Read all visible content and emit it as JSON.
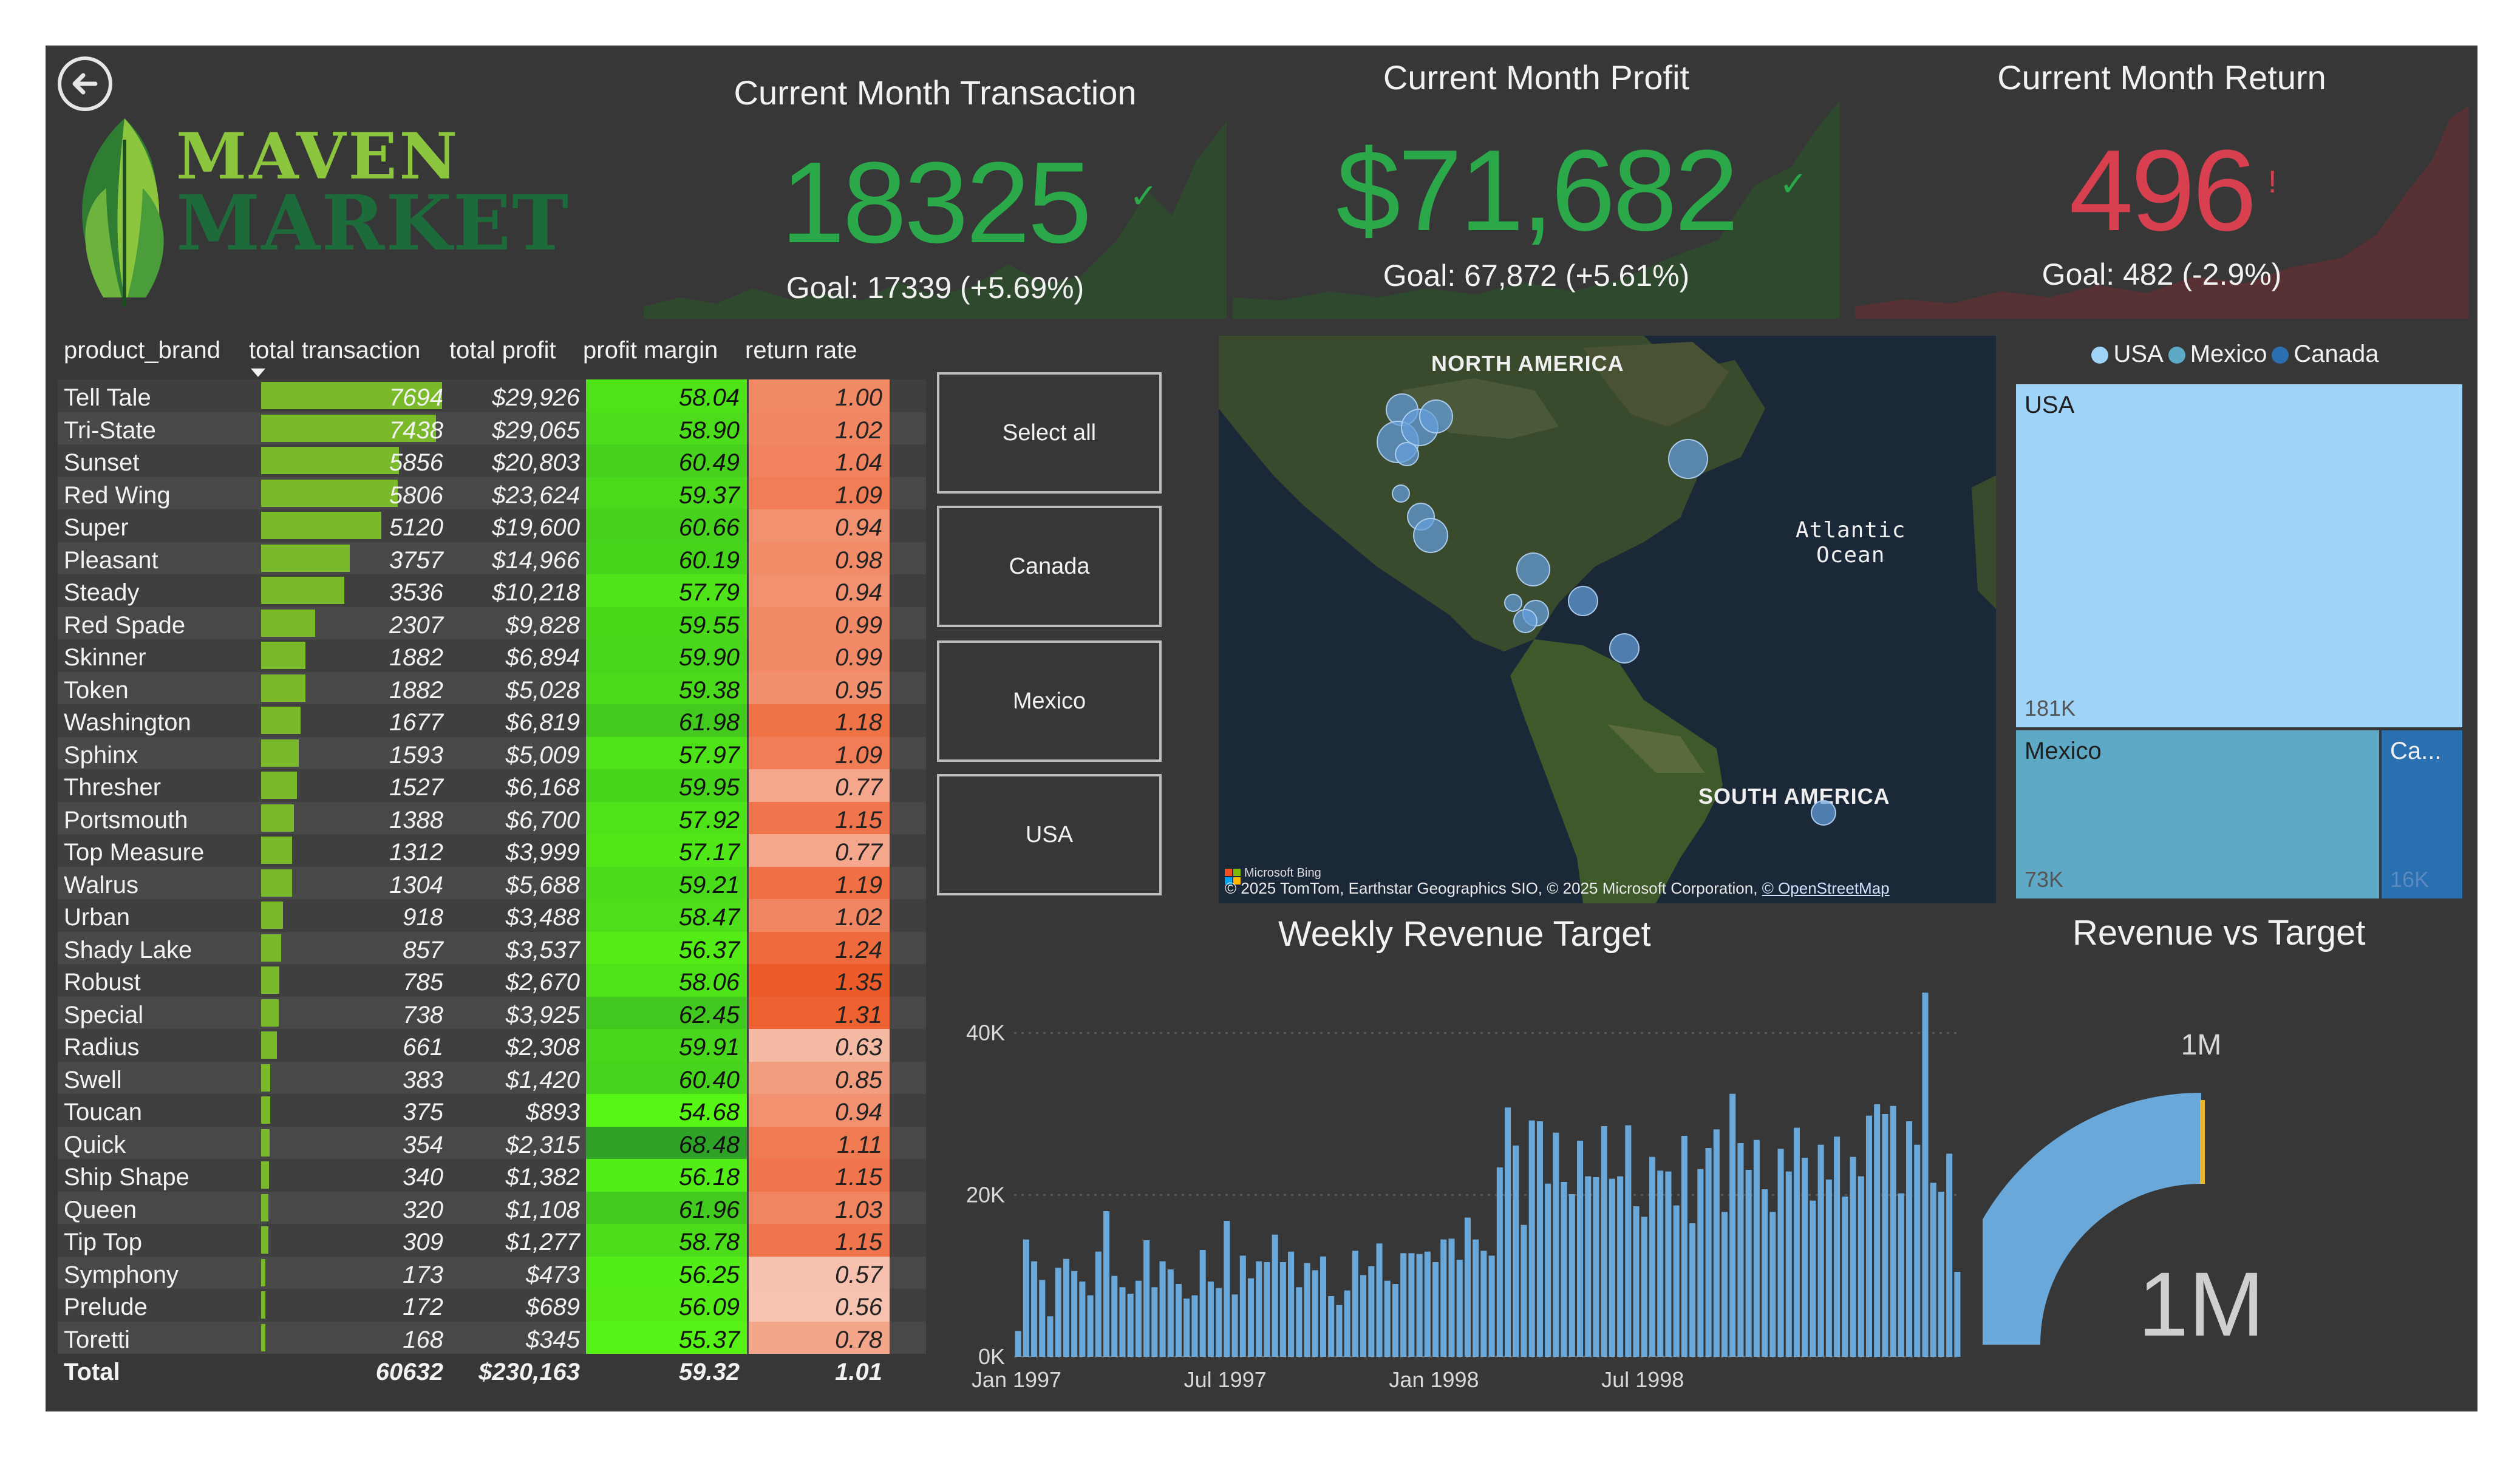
{
  "colors": {
    "background": "#373737",
    "kpi_good": "#2aa84a",
    "kpi_bad": "#d9404f",
    "bar": "#7aba2a",
    "usa": "#9fd3f7",
    "mexico": "#5ea9c6",
    "canada": "#2a6fb0",
    "weekly_bar": "#6aa8d9",
    "gauge": "#6aa8d9"
  },
  "header": {
    "back_icon": "back-arrow-icon",
    "logo_line1": "MAVEN",
    "logo_line2": "MARKET"
  },
  "kpis": [
    {
      "title": "Current Month Transaction",
      "value": "18325",
      "goal": "Goal: 17339 (+5.69%)",
      "status": "check-icon",
      "status_glyph": "✓"
    },
    {
      "title": "Current Month Profit",
      "value": "$71,682",
      "goal": "Goal: 67,872 (+5.61%)",
      "status": "check-icon",
      "status_glyph": "✓"
    },
    {
      "title": "Current Month Return",
      "value": "496",
      "goal": "Goal: 482 (-2.9%)",
      "status": "warning-icon",
      "status_glyph": "!"
    }
  ],
  "table": {
    "columns": [
      "product_brand",
      "total transaction",
      "total profit",
      "profit margin",
      "return rate"
    ],
    "sort_indicator": "sort-desc-icon",
    "rows": [
      {
        "brand": "Tell Tale",
        "tx": 7694,
        "tx_label": "7694",
        "profit": "$29,926",
        "margin": "58.04",
        "rr": "1.00"
      },
      {
        "brand": "Tri-State",
        "tx": 7438,
        "tx_label": "7438",
        "profit": "$29,065",
        "margin": "58.90",
        "rr": "1.02"
      },
      {
        "brand": "Sunset",
        "tx": 5856,
        "tx_label": "5856",
        "profit": "$20,803",
        "margin": "60.49",
        "rr": "1.04"
      },
      {
        "brand": "Red Wing",
        "tx": 5806,
        "tx_label": "5806",
        "profit": "$23,624",
        "margin": "59.37",
        "rr": "1.09"
      },
      {
        "brand": "Super",
        "tx": 5120,
        "tx_label": "5120",
        "profit": "$19,600",
        "margin": "60.66",
        "rr": "0.94"
      },
      {
        "brand": "Pleasant",
        "tx": 3757,
        "tx_label": "3757",
        "profit": "$14,966",
        "margin": "60.19",
        "rr": "0.98"
      },
      {
        "brand": "Steady",
        "tx": 3536,
        "tx_label": "3536",
        "profit": "$10,218",
        "margin": "57.79",
        "rr": "0.94"
      },
      {
        "brand": "Red Spade",
        "tx": 2307,
        "tx_label": "2307",
        "profit": "$9,828",
        "margin": "59.55",
        "rr": "0.99"
      },
      {
        "brand": "Skinner",
        "tx": 1882,
        "tx_label": "1882",
        "profit": "$6,894",
        "margin": "59.90",
        "rr": "0.99"
      },
      {
        "brand": "Token",
        "tx": 1882,
        "tx_label": "1882",
        "profit": "$5,028",
        "margin": "59.38",
        "rr": "0.95"
      },
      {
        "brand": "Washington",
        "tx": 1677,
        "tx_label": "1677",
        "profit": "$6,819",
        "margin": "61.98",
        "rr": "1.18"
      },
      {
        "brand": "Sphinx",
        "tx": 1593,
        "tx_label": "1593",
        "profit": "$5,009",
        "margin": "57.97",
        "rr": "1.09"
      },
      {
        "brand": "Thresher",
        "tx": 1527,
        "tx_label": "1527",
        "profit": "$6,168",
        "margin": "59.95",
        "rr": "0.77"
      },
      {
        "brand": "Portsmouth",
        "tx": 1388,
        "tx_label": "1388",
        "profit": "$6,700",
        "margin": "57.92",
        "rr": "1.15"
      },
      {
        "brand": "Top Measure",
        "tx": 1312,
        "tx_label": "1312",
        "profit": "$3,999",
        "margin": "57.17",
        "rr": "0.77"
      },
      {
        "brand": "Walrus",
        "tx": 1304,
        "tx_label": "1304",
        "profit": "$5,688",
        "margin": "59.21",
        "rr": "1.19"
      },
      {
        "brand": "Urban",
        "tx": 918,
        "tx_label": "918",
        "profit": "$3,488",
        "margin": "58.47",
        "rr": "1.02"
      },
      {
        "brand": "Shady Lake",
        "tx": 857,
        "tx_label": "857",
        "profit": "$3,537",
        "margin": "56.37",
        "rr": "1.24"
      },
      {
        "brand": "Robust",
        "tx": 785,
        "tx_label": "785",
        "profit": "$2,670",
        "margin": "58.06",
        "rr": "1.35"
      },
      {
        "brand": "Special",
        "tx": 738,
        "tx_label": "738",
        "profit": "$3,925",
        "margin": "62.45",
        "rr": "1.31"
      },
      {
        "brand": "Radius",
        "tx": 661,
        "tx_label": "661",
        "profit": "$2,308",
        "margin": "59.91",
        "rr": "0.63"
      },
      {
        "brand": "Swell",
        "tx": 383,
        "tx_label": "383",
        "profit": "$1,420",
        "margin": "60.40",
        "rr": "0.85"
      },
      {
        "brand": "Toucan",
        "tx": 375,
        "tx_label": "375",
        "profit": "$893",
        "margin": "54.68",
        "rr": "0.94"
      },
      {
        "brand": "Quick",
        "tx": 354,
        "tx_label": "354",
        "profit": "$2,315",
        "margin": "68.48",
        "rr": "1.11"
      },
      {
        "brand": "Ship Shape",
        "tx": 340,
        "tx_label": "340",
        "profit": "$1,382",
        "margin": "56.18",
        "rr": "1.15"
      },
      {
        "brand": "Queen",
        "tx": 320,
        "tx_label": "320",
        "profit": "$1,108",
        "margin": "61.96",
        "rr": "1.03"
      },
      {
        "brand": "Tip Top",
        "tx": 309,
        "tx_label": "309",
        "profit": "$1,277",
        "margin": "58.78",
        "rr": "1.15"
      },
      {
        "brand": "Symphony",
        "tx": 173,
        "tx_label": "173",
        "profit": "$473",
        "margin": "56.25",
        "rr": "0.57"
      },
      {
        "brand": "Prelude",
        "tx": 172,
        "tx_label": "172",
        "profit": "$689",
        "margin": "56.09",
        "rr": "0.56"
      },
      {
        "brand": "Toretti",
        "tx": 168,
        "tx_label": "168",
        "profit": "$345",
        "margin": "55.37",
        "rr": "0.78"
      }
    ],
    "total": {
      "label": "Total",
      "tx": "60632",
      "profit": "$230,163",
      "margin": "59.32",
      "rr": "1.01"
    }
  },
  "slicer": {
    "options": [
      "Select all",
      "Canada",
      "Mexico",
      "USA"
    ]
  },
  "map": {
    "labels": [
      "NORTH AMERICA",
      "Atlantic\nOcean",
      "SOUTH AMERICA"
    ],
    "attribution_brand": "Microsoft Bing",
    "attribution": "© 2025 TomTom, Earthstar Geographics SIO, © 2025 Microsoft Corporation,",
    "attribution_link": "© OpenStreetMap"
  },
  "treemap": {
    "legend": [
      {
        "name": "USA",
        "color": "#9fd3f7"
      },
      {
        "name": "Mexico",
        "color": "#5ea9c6"
      },
      {
        "name": "Canada",
        "color": "#2a6fb0"
      }
    ],
    "cells": [
      {
        "name": "USA",
        "value": "181K"
      },
      {
        "name": "Mexico",
        "value": "73K"
      },
      {
        "name": "Ca...",
        "value": "16K"
      }
    ]
  },
  "weekly": {
    "title": "Weekly Revenue Target",
    "y_ticks": [
      "40K",
      "20K",
      "0K"
    ],
    "x_ticks": [
      "Jan 1997",
      "Jul 1997",
      "Jan 1998",
      "Jul 1998"
    ]
  },
  "gauge": {
    "title": "Revenue vs Target",
    "target_label": "1M",
    "value_label": "1M",
    "fill_fraction": 0.99
  },
  "chart_data": {
    "type": "bar",
    "title": "Weekly Revenue Target",
    "xlabel": "",
    "ylabel": "",
    "ylim": [
      0,
      45000
    ],
    "x_ticks": [
      "Jan 1997",
      "Jul 1997",
      "Jan 1998",
      "Jul 1998"
    ],
    "values": [
      3200,
      14500,
      11800,
      9500,
      5000,
      11000,
      12100,
      10600,
      9300,
      7600,
      13000,
      18000,
      10000,
      8600,
      7800,
      9400,
      14400,
      8600,
      11800,
      10800,
      9000,
      7200,
      7600,
      13200,
      9300,
      8500,
      16800,
      7700,
      12500,
      9700,
      11800,
      11700,
      15100,
      11700,
      13000,
      8600,
      11600,
      10700,
      12400,
      7500,
      6400,
      8200,
      13100,
      10100,
      11200,
      14000,
      9400,
      9000,
      12800,
      12800,
      12700,
      13000,
      11700,
      14500,
      14600,
      12000,
      17200,
      14500,
      13100,
      12500,
      23400,
      30800,
      26100,
      16300,
      29200,
      29100,
      21400,
      27700,
      21600,
      20100,
      26700,
      22300,
      22200,
      28500,
      22000,
      22300,
      28600,
      18600,
      17300,
      24700,
      23000,
      22900,
      18700,
      27300,
      16500,
      23200,
      25800,
      28100,
      17900,
      32500,
      26400,
      23100,
      26800,
      20700,
      17900,
      25700,
      22900,
      28300,
      24600,
      19300,
      26200,
      21900,
      27200,
      19800,
      24700,
      22300,
      29800,
      31200,
      30000,
      31000,
      20200,
      29100,
      26200,
      45000,
      21500,
      20400,
      25100,
      10500
    ]
  }
}
